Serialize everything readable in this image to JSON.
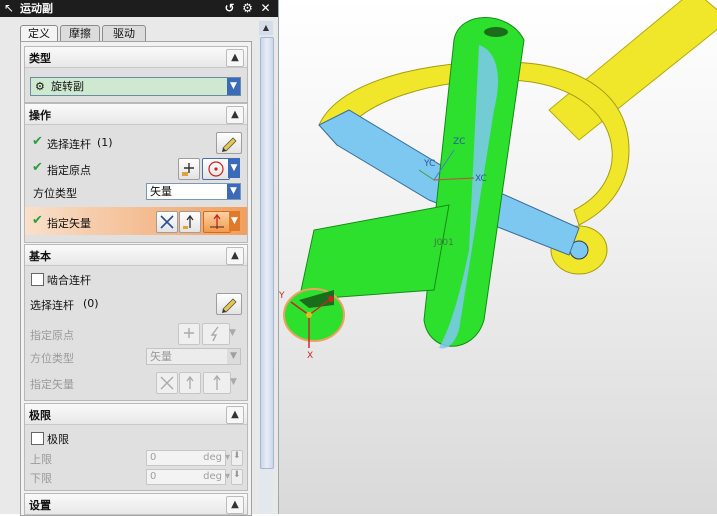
{
  "window": {
    "title": "运动副"
  },
  "tabs": [
    "定义",
    "摩擦",
    "驱动"
  ],
  "sections": {
    "type": {
      "label": "类型",
      "selected": "旋转副"
    },
    "operation": {
      "label": "操作",
      "select_link": "选择连杆",
      "select_link_count": "(1)",
      "origin": "指定原点",
      "orient_type": "方位类型",
      "orient_value": "矢量",
      "vector": "指定矢量"
    },
    "base": {
      "label": "基本",
      "mesh_link": "啮合连杆",
      "select_link": "选择连杆",
      "select_link_count": "(0)",
      "origin": "指定原点",
      "orient_type": "方位类型",
      "orient_value": "矢量",
      "vector": "指定矢量"
    },
    "limits": {
      "label": "极限",
      "limit_checkbox": "极限",
      "upper": "上限",
      "lower": "下限",
      "upper_value": "0",
      "lower_value": "0",
      "unit": "deg"
    },
    "settings": {
      "label": "设置"
    }
  },
  "viewport": {
    "labels": {
      "zc": "ZC",
      "yc": "YC",
      "xc": "XC",
      "joint": "J001",
      "y": "Y",
      "x": "X"
    }
  },
  "colors": {
    "green": "#2ee02e",
    "yellow": "#f0e62a",
    "blue": "#7cc8f0",
    "highlight": "#f0a060"
  }
}
